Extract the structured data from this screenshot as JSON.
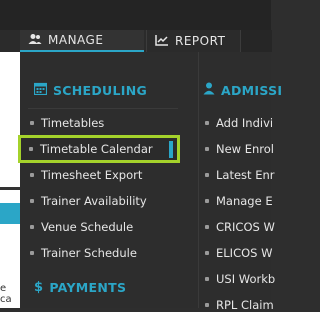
{
  "nav": {
    "tabs": [
      {
        "label": "MANAGE",
        "icon": "users-icon"
      },
      {
        "label": "REPORT",
        "icon": "chart-icon"
      }
    ]
  },
  "menu": {
    "scheduling": {
      "heading": "SCHEDULING",
      "icon": "calendar-icon",
      "items": [
        "Timetables",
        "Timetable Calendar",
        "Timesheet Export",
        "Trainer Availability",
        "Venue Schedule",
        "Trainer Schedule"
      ],
      "selected": "Timetable Calendar"
    },
    "payments": {
      "heading": "PAYMENTS",
      "icon": "dollar-icon"
    },
    "admissions": {
      "heading": "ADMISSI",
      "icon": "user-icon",
      "items": [
        "Add Indivi",
        "New Enrol",
        "Latest Enr",
        "Manage E",
        "CRICOS W",
        "ELICOS W",
        "USI Workb",
        "RPL Claim"
      ]
    }
  },
  "background": {
    "fragment": "e ca"
  },
  "colors": {
    "accent": "#2ba6c7",
    "highlight": "#a4d22b",
    "panel": "#2d2d2d"
  }
}
